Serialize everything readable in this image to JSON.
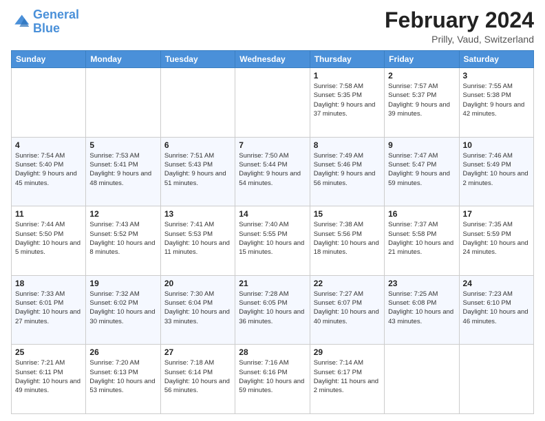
{
  "header": {
    "logo_line1": "General",
    "logo_line2": "Blue",
    "title": "February 2024",
    "subtitle": "Prilly, Vaud, Switzerland"
  },
  "days_of_week": [
    "Sunday",
    "Monday",
    "Tuesday",
    "Wednesday",
    "Thursday",
    "Friday",
    "Saturday"
  ],
  "weeks": [
    [
      {
        "day": "",
        "info": ""
      },
      {
        "day": "",
        "info": ""
      },
      {
        "day": "",
        "info": ""
      },
      {
        "day": "",
        "info": ""
      },
      {
        "day": "1",
        "info": "Sunrise: 7:58 AM\nSunset: 5:35 PM\nDaylight: 9 hours\nand 37 minutes."
      },
      {
        "day": "2",
        "info": "Sunrise: 7:57 AM\nSunset: 5:37 PM\nDaylight: 9 hours\nand 39 minutes."
      },
      {
        "day": "3",
        "info": "Sunrise: 7:55 AM\nSunset: 5:38 PM\nDaylight: 9 hours\nand 42 minutes."
      }
    ],
    [
      {
        "day": "4",
        "info": "Sunrise: 7:54 AM\nSunset: 5:40 PM\nDaylight: 9 hours\nand 45 minutes."
      },
      {
        "day": "5",
        "info": "Sunrise: 7:53 AM\nSunset: 5:41 PM\nDaylight: 9 hours\nand 48 minutes."
      },
      {
        "day": "6",
        "info": "Sunrise: 7:51 AM\nSunset: 5:43 PM\nDaylight: 9 hours\nand 51 minutes."
      },
      {
        "day": "7",
        "info": "Sunrise: 7:50 AM\nSunset: 5:44 PM\nDaylight: 9 hours\nand 54 minutes."
      },
      {
        "day": "8",
        "info": "Sunrise: 7:49 AM\nSunset: 5:46 PM\nDaylight: 9 hours\nand 56 minutes."
      },
      {
        "day": "9",
        "info": "Sunrise: 7:47 AM\nSunset: 5:47 PM\nDaylight: 9 hours\nand 59 minutes."
      },
      {
        "day": "10",
        "info": "Sunrise: 7:46 AM\nSunset: 5:49 PM\nDaylight: 10 hours\nand 2 minutes."
      }
    ],
    [
      {
        "day": "11",
        "info": "Sunrise: 7:44 AM\nSunset: 5:50 PM\nDaylight: 10 hours\nand 5 minutes."
      },
      {
        "day": "12",
        "info": "Sunrise: 7:43 AM\nSunset: 5:52 PM\nDaylight: 10 hours\nand 8 minutes."
      },
      {
        "day": "13",
        "info": "Sunrise: 7:41 AM\nSunset: 5:53 PM\nDaylight: 10 hours\nand 11 minutes."
      },
      {
        "day": "14",
        "info": "Sunrise: 7:40 AM\nSunset: 5:55 PM\nDaylight: 10 hours\nand 15 minutes."
      },
      {
        "day": "15",
        "info": "Sunrise: 7:38 AM\nSunset: 5:56 PM\nDaylight: 10 hours\nand 18 minutes."
      },
      {
        "day": "16",
        "info": "Sunrise: 7:37 AM\nSunset: 5:58 PM\nDaylight: 10 hours\nand 21 minutes."
      },
      {
        "day": "17",
        "info": "Sunrise: 7:35 AM\nSunset: 5:59 PM\nDaylight: 10 hours\nand 24 minutes."
      }
    ],
    [
      {
        "day": "18",
        "info": "Sunrise: 7:33 AM\nSunset: 6:01 PM\nDaylight: 10 hours\nand 27 minutes."
      },
      {
        "day": "19",
        "info": "Sunrise: 7:32 AM\nSunset: 6:02 PM\nDaylight: 10 hours\nand 30 minutes."
      },
      {
        "day": "20",
        "info": "Sunrise: 7:30 AM\nSunset: 6:04 PM\nDaylight: 10 hours\nand 33 minutes."
      },
      {
        "day": "21",
        "info": "Sunrise: 7:28 AM\nSunset: 6:05 PM\nDaylight: 10 hours\nand 36 minutes."
      },
      {
        "day": "22",
        "info": "Sunrise: 7:27 AM\nSunset: 6:07 PM\nDaylight: 10 hours\nand 40 minutes."
      },
      {
        "day": "23",
        "info": "Sunrise: 7:25 AM\nSunset: 6:08 PM\nDaylight: 10 hours\nand 43 minutes."
      },
      {
        "day": "24",
        "info": "Sunrise: 7:23 AM\nSunset: 6:10 PM\nDaylight: 10 hours\nand 46 minutes."
      }
    ],
    [
      {
        "day": "25",
        "info": "Sunrise: 7:21 AM\nSunset: 6:11 PM\nDaylight: 10 hours\nand 49 minutes."
      },
      {
        "day": "26",
        "info": "Sunrise: 7:20 AM\nSunset: 6:13 PM\nDaylight: 10 hours\nand 53 minutes."
      },
      {
        "day": "27",
        "info": "Sunrise: 7:18 AM\nSunset: 6:14 PM\nDaylight: 10 hours\nand 56 minutes."
      },
      {
        "day": "28",
        "info": "Sunrise: 7:16 AM\nSunset: 6:16 PM\nDaylight: 10 hours\nand 59 minutes."
      },
      {
        "day": "29",
        "info": "Sunrise: 7:14 AM\nSunset: 6:17 PM\nDaylight: 11 hours\nand 2 minutes."
      },
      {
        "day": "",
        "info": ""
      },
      {
        "day": "",
        "info": ""
      }
    ]
  ]
}
